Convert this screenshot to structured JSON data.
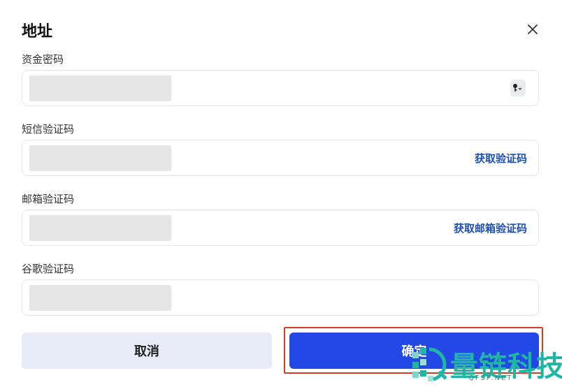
{
  "dialog": {
    "title": "地址",
    "close_label": "×"
  },
  "fields": [
    {
      "label": "资金密码",
      "value": "",
      "placeholder": "",
      "action": ""
    },
    {
      "label": "短信验证码",
      "value": "",
      "placeholder": "",
      "action": "获取验证码"
    },
    {
      "label": "邮箱验证码",
      "value": "",
      "placeholder": "",
      "action": "获取邮箱验证码"
    },
    {
      "label": "谷歌验证码",
      "value": "",
      "placeholder": "",
      "action": ""
    }
  ],
  "buttons": {
    "cancel_label": "取消",
    "confirm_label": "确定"
  },
  "watermark": {
    "text": "量链科技",
    "sub": "QFSP.NET"
  },
  "colors": {
    "accent": "#2249e6",
    "action_link": "#1d4fb8",
    "highlight_border": "#d83a25",
    "cancel_bg": "#e8ecf6",
    "watermark": "#1fb7a4"
  },
  "icons": {
    "close": "close-icon",
    "key": "key-icon"
  }
}
